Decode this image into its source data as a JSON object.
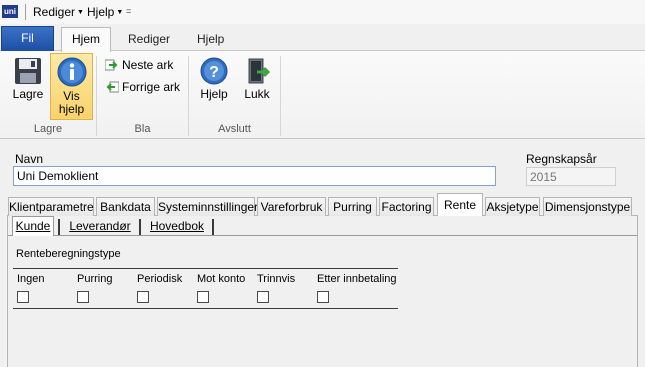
{
  "quickbar": {
    "logo": "uni",
    "menu_rediger": "Rediger",
    "menu_hjelp": "Hjelp",
    "customize": "="
  },
  "ribbon_tabs": {
    "fil": "Fil",
    "hjem": "Hjem",
    "rediger": "Rediger",
    "hjelp": "Hjelp"
  },
  "ribbon": {
    "lagre": "Lagre",
    "vis_hjelp_line1": "Vis",
    "vis_hjelp_line2": "hjelp",
    "neste_ark": "Neste ark",
    "forrige_ark": "Forrige ark",
    "hjelp": "Hjelp",
    "lukk": "Lukk",
    "group_lagre": "Lagre",
    "group_bla": "Bla",
    "group_avslutt": "Avslutt"
  },
  "form": {
    "navn_label": "Navn",
    "navn_value": "Uni Demoklient",
    "year_label": "Regnskapsår",
    "year_value": "2015"
  },
  "main_tabs": [
    "Klientparametre",
    "Bankdata",
    "Systeminnstillinger",
    "Vareforbruk",
    "Purring",
    "Factoring",
    "Rente",
    "Aksjetype",
    "Dimensjonstype"
  ],
  "sub_tabs": [
    "Kunde",
    "Leverandør",
    "Hovedbok"
  ],
  "rente": {
    "section_label": "Renteberegningstype",
    "options": [
      "Ingen",
      "Purring",
      "Periodisk",
      "Mot konto",
      "Trinnvis",
      "Etter innbetaling"
    ]
  },
  "colors": {
    "accent_blue": "#1c4fa3",
    "active_button": "#f9d36b",
    "input_border": "#7da2ce"
  }
}
